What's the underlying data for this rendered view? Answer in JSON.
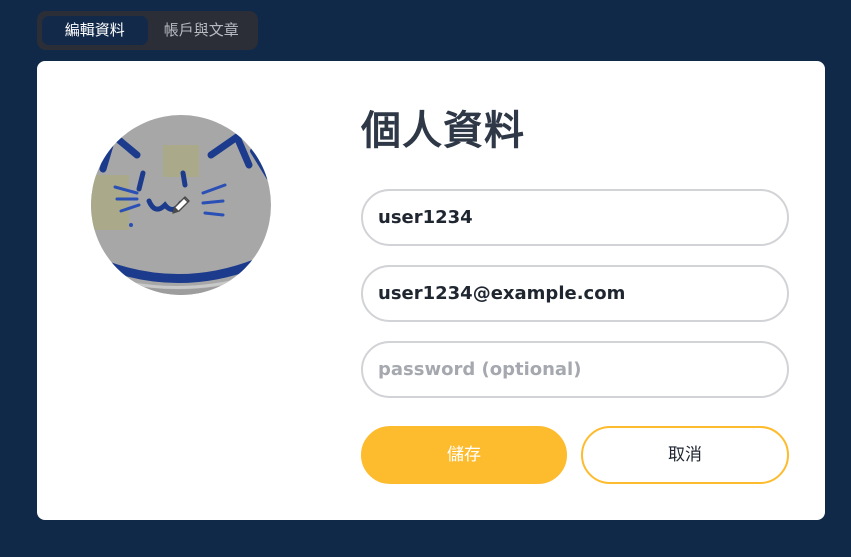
{
  "tabs": {
    "edit_profile": "編輯資料",
    "account_posts": "帳戶與文章"
  },
  "profile": {
    "title": "個人資料",
    "username_value": "user1234",
    "email_value": "user1234@example.com",
    "password_placeholder": "password (optional)",
    "password_value": "",
    "avatar_icon": "pencil-icon"
  },
  "actions": {
    "save_label": "儲存",
    "cancel_label": "取消"
  },
  "colors": {
    "background": "#112949",
    "accent": "#fdbb2e",
    "tab_bar": "#2b2e36",
    "active_tab": "#12294a"
  }
}
